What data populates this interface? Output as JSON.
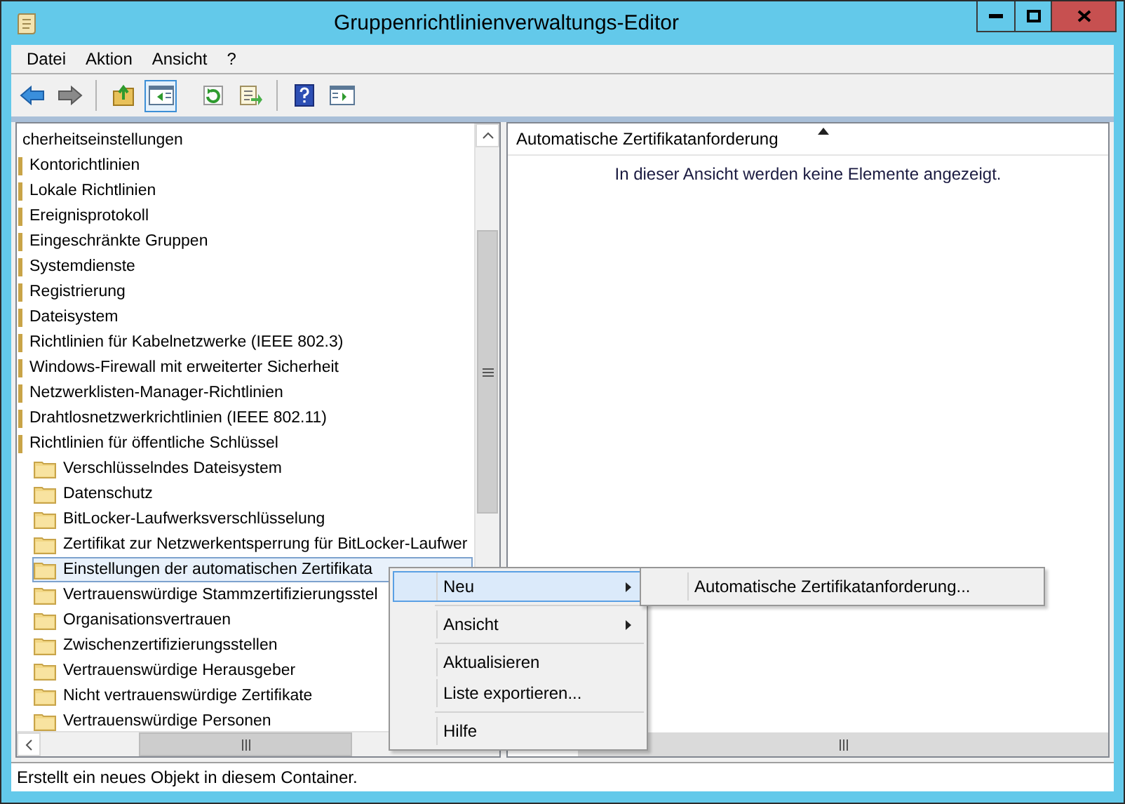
{
  "window": {
    "title": "Gruppenrichtlinienverwaltungs-Editor"
  },
  "menu_bar": [
    {
      "label": "Datei"
    },
    {
      "label": "Aktion"
    },
    {
      "label": "Ansicht"
    },
    {
      "label": "?"
    }
  ],
  "toolbar": [
    {
      "pressed": false
    },
    {
      "pressed": false
    },
    {
      "pressed": false
    },
    {
      "pressed": true
    },
    {
      "pressed": false
    },
    {
      "pressed": false
    },
    {
      "pressed": false
    },
    {
      "pressed": false
    }
  ],
  "tree": [
    {
      "label": "cherheitseinstellungen",
      "selected": false,
      "children": [
        {
          "label": "Kontorichtlinien",
          "selected": false
        },
        {
          "label": "Lokale Richtlinien",
          "selected": false
        },
        {
          "label": "Ereignisprotokoll",
          "selected": false
        },
        {
          "label": "Eingeschränkte Gruppen",
          "selected": false
        },
        {
          "label": "Systemdienste",
          "selected": false
        },
        {
          "label": "Registrierung",
          "selected": false
        },
        {
          "label": "Dateisystem",
          "selected": false
        },
        {
          "label": "Richtlinien für Kabelnetzwerke (IEEE 802.3)",
          "selected": false
        },
        {
          "label": "Windows-Firewall mit erweiterter Sicherheit",
          "selected": false
        },
        {
          "label": "Netzwerklisten-Manager-Richtlinien",
          "selected": false
        },
        {
          "label": "Drahtlosnetzwerkrichtlinien (IEEE 802.11)",
          "selected": false
        },
        {
          "label": "Richtlinien für öffentliche Schlüssel",
          "selected": false,
          "children": [
            {
              "label": "Verschlüsselndes Dateisystem",
              "selected": false
            },
            {
              "label": "Datenschutz",
              "selected": false
            },
            {
              "label": "BitLocker-Laufwerksverschlüsselung",
              "selected": false
            },
            {
              "label": "Zertifikat zur Netzwerkentsperrung für BitLocker-Laufwer",
              "selected": false
            },
            {
              "label": "Einstellungen der automatischen Zertifikata",
              "selected": true
            },
            {
              "label": "Vertrauenswürdige Stammzertifizierungsstel",
              "selected": false
            },
            {
              "label": "Organisationsvertrauen",
              "selected": false
            },
            {
              "label": "Zwischenzertifizierungsstellen",
              "selected": false
            },
            {
              "label": "Vertrauenswürdige Herausgeber",
              "selected": false
            },
            {
              "label": "Nicht vertrauenswürdige Zertifikate",
              "selected": false
            },
            {
              "label": "Vertrauenswürdige Personen",
              "selected": false
            }
          ]
        }
      ]
    }
  ],
  "list_view": {
    "columns": [
      {
        "label": "Automatische Zertifikatanforderung",
        "sorted": true
      }
    ],
    "empty_message": "In dieser Ansicht werden keine Elemente angezeigt."
  },
  "context_menu": {
    "items": [
      {
        "kind": "command",
        "label": "Neu",
        "selected": true,
        "has_submenu": true
      },
      {
        "kind": "separator"
      },
      {
        "kind": "command",
        "label": "Ansicht",
        "selected": false,
        "has_submenu": true
      },
      {
        "kind": "separator"
      },
      {
        "kind": "command",
        "label": "Aktualisieren",
        "selected": false,
        "has_submenu": false
      },
      {
        "kind": "command",
        "label": "Liste exportieren...",
        "selected": false,
        "has_submenu": false
      },
      {
        "kind": "separator"
      },
      {
        "kind": "command",
        "label": "Hilfe",
        "selected": false,
        "has_submenu": false
      }
    ]
  },
  "submenu": {
    "items": [
      {
        "kind": "command",
        "label": "Automatische Zertifikatanforderung...",
        "selected": false,
        "has_submenu": false
      }
    ]
  },
  "status_bar": {
    "text": "Erstellt ein neues Objekt in diesem Container."
  }
}
